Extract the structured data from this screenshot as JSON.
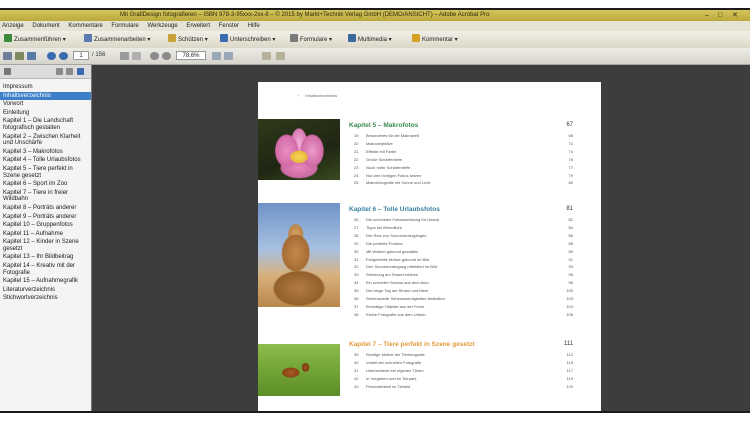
{
  "window": {
    "title": "Mit GrafiDesign fotografieren – ISBN 978-3-95xxx-2xx-8 – © 2015 by Markt+Technik Verlag GmbH (DEMO/ANSICHT) – Adobe Acrobat Pro",
    "controls": [
      "–",
      "□",
      "✕"
    ]
  },
  "menu": [
    "Anzeige",
    "Dokument",
    "Kommentare",
    "Formulare",
    "Werkzeuge",
    "Erweitert",
    "Fenster",
    "Hilfe"
  ],
  "toolbar": {
    "buttons": [
      {
        "label": "Zusammenführen",
        "icon": "create-pdf-icon",
        "color": "#3a8a3a"
      },
      {
        "label": "Zusammenarbeiten",
        "icon": "collaborate-icon",
        "color": "#5a7ab0"
      },
      {
        "label": "Schützen",
        "icon": "lock-icon",
        "color": "#c9a33a"
      },
      {
        "label": "Unterschreiben",
        "icon": "pen-icon",
        "color": "#3a6ab0"
      },
      {
        "label": "Formulare",
        "icon": "form-icon",
        "color": "#7a7a7a"
      },
      {
        "label": "Multimedia",
        "icon": "multimedia-icon",
        "color": "#3a6a9a"
      },
      {
        "label": "Kommentar",
        "icon": "comment-icon",
        "color": "#d8a020"
      }
    ],
    "page_current": "1",
    "page_total": "/ 156",
    "zoom": "78,6%"
  },
  "sidebar": {
    "items": [
      {
        "label": "Impressum",
        "selected": false
      },
      {
        "label": "Inhaltsverzeichnis",
        "selected": true
      },
      {
        "label": "Vorwort",
        "selected": false
      },
      {
        "label": "Einleitung",
        "selected": false
      },
      {
        "label": "Kapitel 1 – Die Landschaft fotografisch gestalten",
        "selected": false
      },
      {
        "label": "Kapitel 2 – Zwischen Klarheit und Unschärfe",
        "selected": false
      },
      {
        "label": "Kapitel 3 – Makrofotos",
        "selected": false
      },
      {
        "label": "Kapitel 4 – Tolle Urlaubsfotos",
        "selected": false
      },
      {
        "label": "Kapitel 5 – Tiere perfekt in Szene gesetzt",
        "selected": false
      },
      {
        "label": "Kapitel 6 – Sport im Zoo",
        "selected": false
      },
      {
        "label": "Kapitel 7 – Tiere in freier Wildbahn",
        "selected": false
      },
      {
        "label": "Kapitel 8 – Porträts anderer",
        "selected": false
      },
      {
        "label": "Kapitel 9 – Porträts anderer",
        "selected": false
      },
      {
        "label": "Kapitel 10 – Gruppenfotos",
        "selected": false
      },
      {
        "label": "Kapitel 11 – Aufnahme",
        "selected": false
      },
      {
        "label": "Kapitel 12 – Kinder in Szene gesetzt",
        "selected": false
      },
      {
        "label": "Kapitel 13 – Ihr Bildbeitrag",
        "selected": false
      },
      {
        "label": "Kapitel 14 – Kreativ mit der Fotografie",
        "selected": false
      },
      {
        "label": "Kapitel 15 – Aufnahmegrafik",
        "selected": false
      },
      {
        "label": "Literaturverzeichnis",
        "selected": false
      },
      {
        "label": "Stichwortverzeichnis",
        "selected": false
      }
    ]
  },
  "page": {
    "running_head": "Inhaltsverzeichnis",
    "chapters": [
      {
        "title": "Kapitel 5 – Makrofotos",
        "page": "67",
        "color": "#3a8a50",
        "entries": [
          {
            "no": "19",
            "title": "Besonderes für die Makrowelt",
            "page": "68"
          },
          {
            "no": "20",
            "title": "Makroobjektive",
            "page": "72"
          },
          {
            "no": "21",
            "title": "Effekte mit Farbe",
            "page": "74"
          },
          {
            "no": "22",
            "title": "Große Schärfentiefe",
            "page": "76"
          },
          {
            "no": "23",
            "title": "Noch mehr Schärfentiefe",
            "page": "77"
          },
          {
            "no": "24",
            "title": "Nur den richtigen Fokus setzen",
            "page": "79"
          },
          {
            "no": "25",
            "title": "Makrofotografie mit Sonne und Licht",
            "page": "80"
          }
        ]
      },
      {
        "title": "Kapitel 6 – Tolle Urlaubsfotos",
        "page": "81",
        "color": "#3a7fa0",
        "entries": [
          {
            "no": "26",
            "title": "Die schönsten Fotoausrüstung für Urlaub",
            "page": "82"
          },
          {
            "no": "27",
            "title": "Tipps bei Abendlicht",
            "page": "84"
          },
          {
            "no": "28",
            "title": "Der Reiz von Sonnenuntergängen",
            "page": "86"
          },
          {
            "no": "29",
            "title": "Die perfekte Position",
            "page": "88"
          },
          {
            "no": "30",
            "title": "Mit Wolken gekonnt gestalten",
            "page": "89"
          },
          {
            "no": "31",
            "title": "Freigestellte Motive gekonnt im Bild",
            "page": "91"
          },
          {
            "no": "32",
            "title": "Den Sonnenuntergang reflektiert im Bild",
            "page": "93"
          },
          {
            "no": "33",
            "title": "Stimmung am Strand erleben",
            "page": "95"
          },
          {
            "no": "34",
            "title": "Ein schneller Schuss aus dem Auto",
            "page": "98"
          },
          {
            "no": "35",
            "title": "Der lange Tag am Strand und Meer",
            "page": "100"
          },
          {
            "no": "36",
            "title": "Sehenswerte Sehenswürdigkeiten festhalten",
            "page": "103"
          },
          {
            "no": "37",
            "title": "Einmalige Objekte aus der Ferne",
            "page": "104"
          },
          {
            "no": "38",
            "title": "Kleine Fotografie aus dem Urlaub",
            "page": "106"
          }
        ]
      },
      {
        "title": "Kapitel 7 – Tiere perfekt in Szene gesetzt",
        "page": "111",
        "color": "#e29a38",
        "entries": [
          {
            "no": "39",
            "title": "Richtige Motive der Tierfotografie",
            "page": "112"
          },
          {
            "no": "40",
            "title": "Vorteil der schnellen Fotografie",
            "page": "115"
          },
          {
            "no": "41",
            "title": "Unterschiede bei eigenen Tieren",
            "page": "117"
          },
          {
            "no": "42",
            "title": "In Vorgarten und im Tierpark",
            "page": "119"
          },
          {
            "no": "43",
            "title": "Persönlichkeit im Tierbild",
            "page": "120"
          }
        ]
      }
    ]
  }
}
